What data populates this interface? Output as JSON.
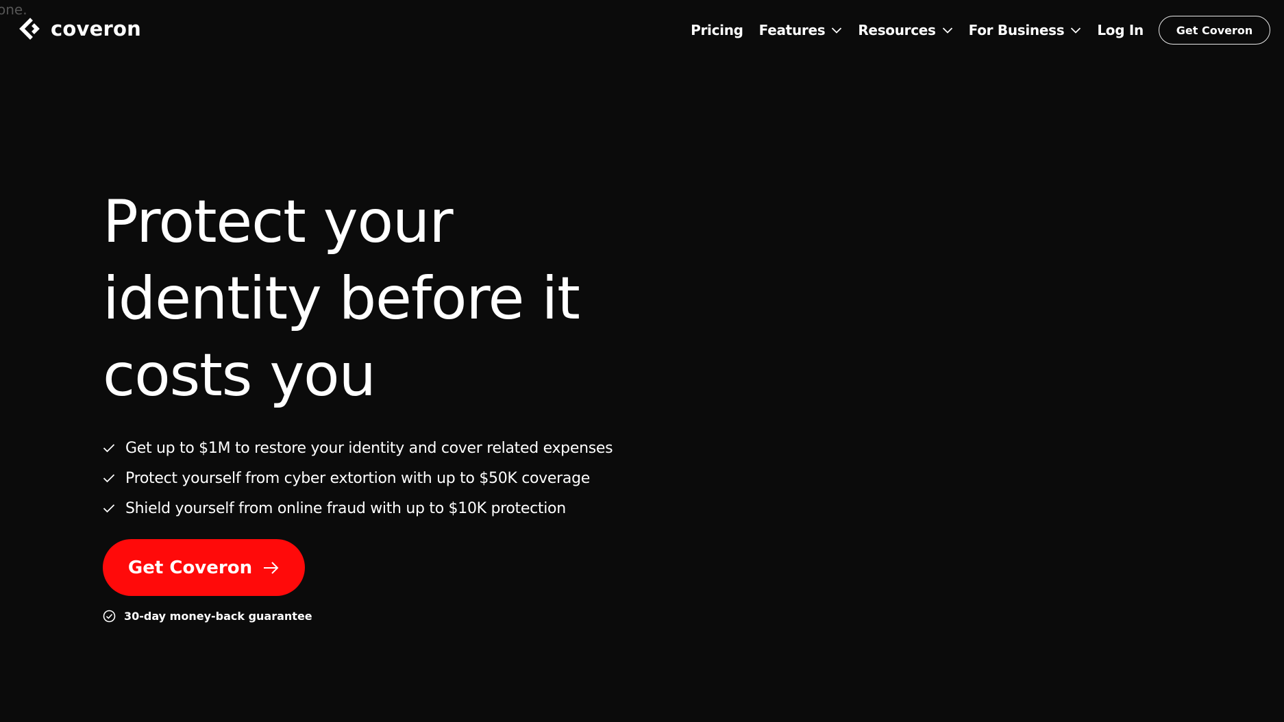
{
  "stray_text": "one.",
  "header": {
    "logo_text": "coveron",
    "nav": [
      {
        "label": "Pricing",
        "has_dropdown": false
      },
      {
        "label": "Features",
        "has_dropdown": true
      },
      {
        "label": "Resources",
        "has_dropdown": true
      },
      {
        "label": "For Business",
        "has_dropdown": true
      },
      {
        "label": "Log In",
        "has_dropdown": false
      }
    ],
    "cta_label": "Get Coveron"
  },
  "hero": {
    "title_lines": [
      "Protect your",
      "identity before it",
      "costs you"
    ],
    "benefits": [
      "Get up to $1M to restore your identity and cover related expenses",
      "Protect yourself from cyber extortion with up to $50K coverage",
      "Shield yourself from online fraud with up to $10K protection"
    ],
    "cta_label": "Get Coveron",
    "guarantee": "30-day money-back guarantee"
  },
  "colors": {
    "background": "#0b0b0b",
    "accent": "#ff0a0a",
    "text": "#ffffff"
  },
  "icons": {
    "logo": "coveron-logo-icon",
    "dropdown": "chevron-down-icon",
    "benefit": "check-icon",
    "cta": "arrow-right-icon",
    "guarantee": "circle-check-icon"
  }
}
